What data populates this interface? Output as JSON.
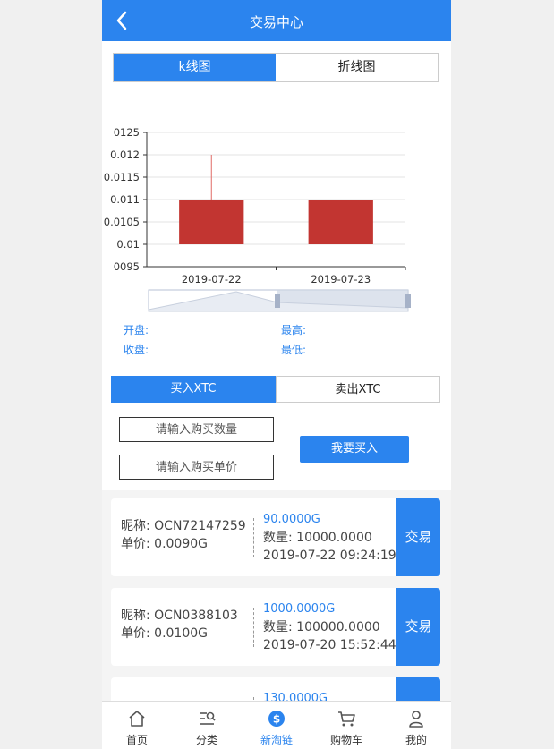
{
  "header": {
    "title": "交易中心"
  },
  "tabs": [
    {
      "label": "k线图"
    },
    {
      "label": "折线图"
    }
  ],
  "chart_data": {
    "type": "candlestick",
    "categories": [
      "2019-07-22",
      "2019-07-23"
    ],
    "candles": [
      {
        "x": "2019-07-22",
        "open": 0.01,
        "close": 0.011,
        "low": 0.01,
        "high": 0.012
      },
      {
        "x": "2019-07-23",
        "open": 0.01,
        "close": 0.011,
        "low": 0.01,
        "high": 0.011
      }
    ],
    "yticks": [
      "0125",
      "0.012",
      "0.0115",
      "0.011",
      "0.0105",
      "0.01",
      "0095"
    ],
    "ylim": [
      0.0095,
      0.0125
    ],
    "grid": true,
    "colors": {
      "candle": "#c23531",
      "wick": "#e06a66"
    }
  },
  "info": {
    "open_label": "开盘:",
    "high_label": "最高:",
    "close_label": "收盘:",
    "low_label": "最低:"
  },
  "trade": {
    "buy_label": "买入XTC",
    "sell_label": "卖出XTC",
    "qty_placeholder": "请输入购买数量",
    "price_placeholder": "请输入购买单价",
    "submit_label": "我要买入"
  },
  "orders": [
    {
      "nickname": "昵称:  OCN72147259",
      "unit_price": "单价:  0.0090G",
      "amount": "90.0000G",
      "quantity": "数量:  10000.0000",
      "time": "2019-07-22 09:24:19",
      "action": "交易"
    },
    {
      "nickname": "昵称:  OCN0388103",
      "unit_price": "单价:  0.0100G",
      "amount": "1000.0000G",
      "quantity": "数量:  100000.0000",
      "time": "2019-07-20 15:52:44",
      "action": "交易"
    },
    {
      "nickname": "",
      "unit_price": "",
      "amount": "130.0000G",
      "quantity": "",
      "time": "",
      "action": ""
    }
  ],
  "tabbar": [
    {
      "label": "首页",
      "icon": "home-icon"
    },
    {
      "label": "分类",
      "icon": "category-icon"
    },
    {
      "label": "新淘链",
      "icon": "coin-icon"
    },
    {
      "label": "购物车",
      "icon": "cart-icon"
    },
    {
      "label": "我的",
      "icon": "user-icon"
    }
  ],
  "colors": {
    "accent": "#2b84ee"
  }
}
